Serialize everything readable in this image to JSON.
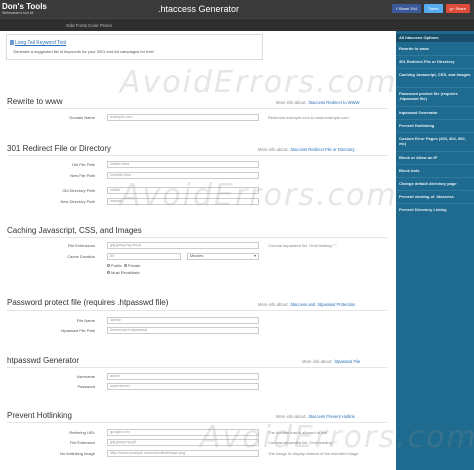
{
  "header": {
    "logo_title": "Don's Tools",
    "logo_sub": "Webmaster's tool kit",
    "app_title": ".htaccess Generator",
    "share": [
      {
        "label": "f Share 344"
      },
      {
        "label": "Tweet"
      },
      {
        "label": "g+ Share"
      }
    ],
    "subnav": [
      "Odd Fonts",
      "Color Picker"
    ]
  },
  "promo": {
    "link": "Long Tail Keyword Tool",
    "text": "Generate a suggested list of keywords for your SEO and Ad campaigns for free!"
  },
  "sections": {
    "rewrite": {
      "title": "Rewrite to www",
      "more_prefix": "More info about:",
      "more_link": ".htaccess Redirect to WWW",
      "domain_label": "Domain Name",
      "domain_placeholder": "example.com",
      "domain_hint": "Redirects example.com to www.example.com"
    },
    "redirect": {
      "title": "301 Redirect File or Directory",
      "more_prefix": "More info about:",
      "more_link": ".htaccess Redirect File or Directory",
      "old_file_label": "Old File Path",
      "old_file_ph": "/oldfile.html",
      "new_file_label": "New File Path",
      "new_file_ph": "/newfile.html",
      "old_dir_label": "Old Directory Path",
      "old_dir_ph": "/olddir",
      "new_dir_label": "New Directory Path",
      "new_dir_ph": "/newdir"
    },
    "caching": {
      "title": "Caching Javascript, CSS, and Images",
      "ext_label": "File Extensions",
      "ext_ph": "jpg,jpeg,png,css,js",
      "ext_hint": "Comma separated list. Omit leading \".\"",
      "duration_label": "Cache Duration",
      "duration_value": "60",
      "duration_unit": "Minutes",
      "radio_public": "Public",
      "radio_private": "Private",
      "radio_must": "Must Revalidate"
    },
    "password": {
      "title": "Password protect file (requires .htpasswd file)",
      "more_prefix": "More info about:",
      "more_link": ".htaccess and .htpasswd Protection",
      "file_label": "File Name",
      "file_ph": "/admin",
      "htpasswd_label": ".htpasswd File Path",
      "htpasswd_ph": "/home/user/.htpasswd"
    },
    "htpasswd": {
      "title": "htpasswd Generator",
      "more_prefix": "More info about:",
      "more_link": ".htpasswd File",
      "user_label": "Username",
      "user_ph": "admin",
      "pass_label": "Password",
      "pass_ph": "supersecret"
    },
    "hotlink": {
      "title": "Prevent Hotlinking",
      "more_prefix": "More info about:",
      "more_link": ".htaccess Prevent Hotlink",
      "ref_label": "Referring URL",
      "ref_ph": "google.com",
      "ref_hint": "The domain that is allowed to link",
      "ext_label": "File Extension",
      "ext_ph": "jpg,jpeg,png,gif",
      "ext_hint": "Comma-separated list. Omit leading \".\"",
      "img_label": "No hotlinking image",
      "img_ph": "http://www.example.com/nohotlinkimage.png",
      "img_hint": "The image to display instead of the intended image"
    }
  },
  "sidebar": {
    "items": [
      "All htaccess Options",
      "Rewrite to www",
      "301 Redirect File or Directory",
      "Caching Javascript, CSS, and Images",
      "Password protect file (requires .htpasswd file)",
      "htpasswd Generator",
      "Prevent Hotlinking",
      "Custom Error Pages (400, 404, 500, etc)",
      "Block or Allow an IP",
      "Block bots",
      "Change default directory page",
      "Prevent viewing of .htaccess",
      "Prevent Directory Listing"
    ]
  },
  "watermark": "AvoidErrors.com",
  "colors": {
    "topbar": "#3a3a3a",
    "sidebar": "#1f6b8f",
    "link": "#2a6eb5"
  }
}
